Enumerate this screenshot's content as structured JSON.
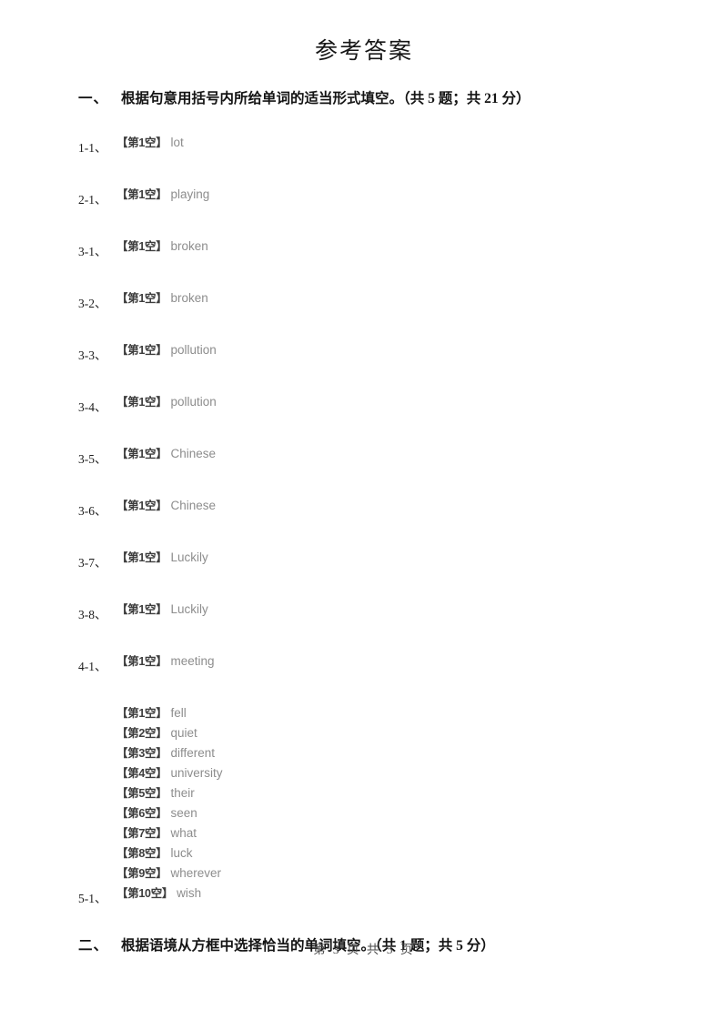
{
  "document": {
    "title": "参考答案",
    "footer": "第 3 页 共 5 页"
  },
  "sections": [
    {
      "number": "一、",
      "heading": "根据句意用括号内所给单词的适当形式填空。（共 5 题；共 21 分）"
    },
    {
      "number": "二、",
      "heading": "根据语境从方框中选择恰当的单词填空。（共 1 题；共 5 分）"
    }
  ],
  "answers": [
    {
      "label": "1-1、",
      "blanks": [
        {
          "tag": "【第1空】",
          "value": "lot"
        }
      ]
    },
    {
      "label": "2-1、",
      "blanks": [
        {
          "tag": "【第1空】",
          "value": "playing"
        }
      ]
    },
    {
      "label": "3-1、",
      "blanks": [
        {
          "tag": "【第1空】",
          "value": "broken"
        }
      ]
    },
    {
      "label": "3-2、",
      "blanks": [
        {
          "tag": "【第1空】",
          "value": "broken"
        }
      ]
    },
    {
      "label": "3-3、",
      "blanks": [
        {
          "tag": "【第1空】",
          "value": "pollution"
        }
      ]
    },
    {
      "label": "3-4、",
      "blanks": [
        {
          "tag": "【第1空】",
          "value": "pollution"
        }
      ]
    },
    {
      "label": "3-5、",
      "blanks": [
        {
          "tag": "【第1空】",
          "value": "Chinese"
        }
      ]
    },
    {
      "label": "3-6、",
      "blanks": [
        {
          "tag": "【第1空】",
          "value": "Chinese"
        }
      ]
    },
    {
      "label": "3-7、",
      "blanks": [
        {
          "tag": "【第1空】",
          "value": "Luckily"
        }
      ]
    },
    {
      "label": "3-8、",
      "blanks": [
        {
          "tag": "【第1空】",
          "value": "Luckily"
        }
      ]
    },
    {
      "label": "4-1、",
      "blanks": [
        {
          "tag": "【第1空】",
          "value": "meeting"
        }
      ]
    },
    {
      "label": "5-1、",
      "blanks": [
        {
          "tag": "【第1空】",
          "value": "fell"
        },
        {
          "tag": "【第2空】",
          "value": "quiet"
        },
        {
          "tag": "【第3空】",
          "value": "different"
        },
        {
          "tag": "【第4空】",
          "value": "university"
        },
        {
          "tag": "【第5空】",
          "value": "their"
        },
        {
          "tag": "【第6空】",
          "value": "seen"
        },
        {
          "tag": "【第7空】",
          "value": "what"
        },
        {
          "tag": "【第8空】",
          "value": "luck"
        },
        {
          "tag": "【第9空】",
          "value": "wherever"
        },
        {
          "tag": "【第10空】",
          "value": "wish"
        }
      ]
    }
  ]
}
